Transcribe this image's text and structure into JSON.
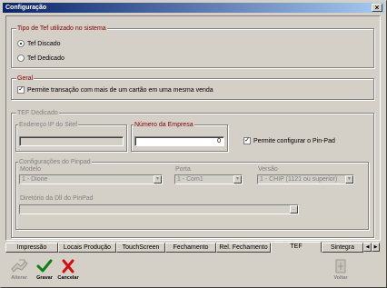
{
  "window": {
    "title": "Configuração",
    "close_symbol": "×"
  },
  "tipo_tef": {
    "legend": "Tipo de Tef utilizado no sistema",
    "options": [
      {
        "label": "Tef Discado",
        "selected": true
      },
      {
        "label": "Tef Dedicado",
        "selected": false
      }
    ]
  },
  "geral": {
    "legend": "Geral",
    "multi_card_label": "Permite transação com mais de um cartão em uma mesma venda",
    "multi_card_checked": true
  },
  "tef_dedicado": {
    "legend": "TEF Dedicado",
    "ip_label": "Endereço IP do Sitef",
    "ip_value": "",
    "empresa_label": "Número da Empresa",
    "empresa_value": "0",
    "pinpad_check_label": "Permite configurar o Pin-Pad",
    "pinpad_check_checked": true,
    "pinpad": {
      "legend": "Configurações do Pinpad",
      "modelo_label": "Modelo",
      "modelo_value": "1 - Dione",
      "porta_label": "Porta",
      "porta_value": "1 - Com1",
      "versao_label": "Versão",
      "versao_value": "1 - CHIP (1121 ou superior)",
      "dll_label": "Diretório da Dll do PinPad",
      "dll_value": ""
    }
  },
  "tabs": [
    {
      "label": "Impressão",
      "active": false
    },
    {
      "label": "Locais Produção",
      "active": false
    },
    {
      "label": "TouchScreen",
      "active": false
    },
    {
      "label": "Fechamento",
      "active": false
    },
    {
      "label": "Rel. Fechamento",
      "active": false
    },
    {
      "label": "TEF",
      "active": true
    },
    {
      "label": "Sintegra",
      "active": false
    }
  ],
  "toolbar": {
    "alterar_label": "Alterar",
    "gravar_label": "Gravar",
    "cancelar_label": "Cancelar",
    "voltar_label": "Voltar"
  },
  "colors": {
    "accent_red": "#800000",
    "window_bg": "#d4d0c8",
    "title_gradient_start": "#0a246a",
    "check_green": "#108010",
    "cancel_red": "#d01010"
  }
}
